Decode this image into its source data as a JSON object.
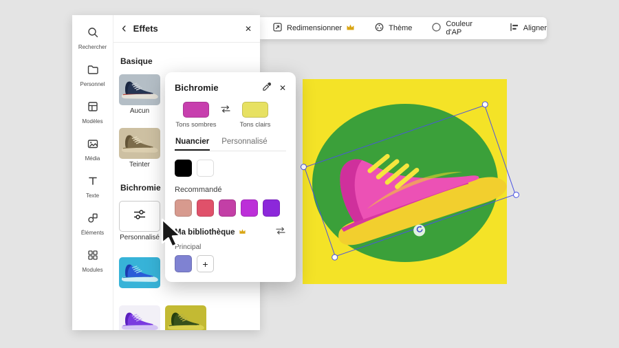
{
  "colors": {
    "accent_blue": "#4a53e2",
    "canvas_yellow": "#f4e327",
    "ellipse_green": "#3ba03a"
  },
  "icons": {
    "back": "‹",
    "close": "✕",
    "add": "+"
  },
  "sidebar": {
    "items": [
      {
        "label": "Rechercher"
      },
      {
        "label": "Personnel"
      },
      {
        "label": "Modèles"
      },
      {
        "label": "Média"
      },
      {
        "label": "Texte"
      },
      {
        "label": "Éléments"
      },
      {
        "label": "Modules"
      }
    ]
  },
  "effects_panel": {
    "title": "Effets",
    "section_basic": "Basique",
    "section_duotone": "Bichromie",
    "effect_none_label": "Aucun",
    "effect_tint_label": "Teinter",
    "effect_custom_label": "Personnalisé"
  },
  "toolbar": {
    "resize_label": "Redimensionner",
    "theme_label": "Thème",
    "bg_color_label": "Couleur d'AP",
    "align_label": "Aligner"
  },
  "popup": {
    "title": "Bichromie",
    "shadows_label": "Tons sombres",
    "highlights_label": "Tons clairs",
    "shadows_color": "#c73fae",
    "highlights_color": "#e7e162",
    "tab_swatches": "Nuancier",
    "tab_custom": "Personnalisé",
    "base_swatches": [
      "#000000",
      "#ffffff"
    ],
    "recommended_label": "Recommandé",
    "recommended_swatches": [
      "#d79a8e",
      "#e0516a",
      "#c33fa6",
      "#bc2fd8",
      "#8c28da"
    ],
    "library_label": "Ma bibliothèque",
    "principal_label": "Principal",
    "principal_swatch": "#7f82d2"
  }
}
